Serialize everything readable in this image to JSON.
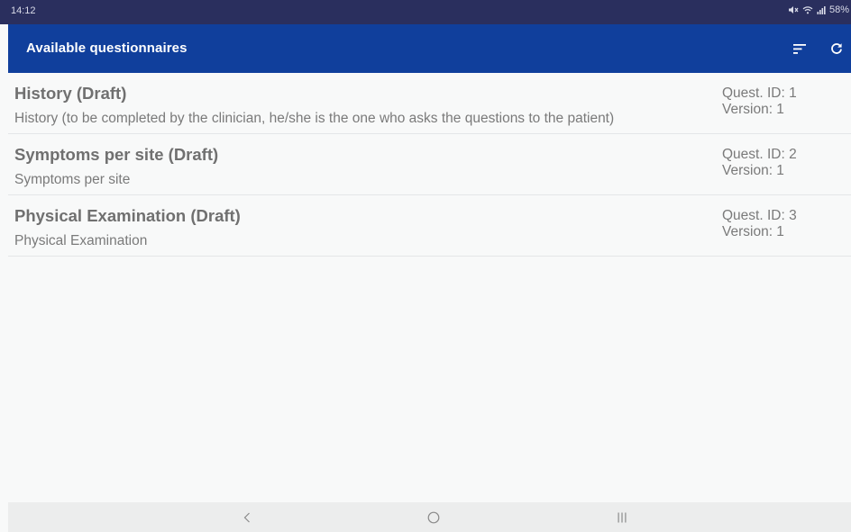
{
  "status_bar": {
    "time": "14:12",
    "battery": "58%"
  },
  "app_bar": {
    "title": "Available questionnaires",
    "actions": [
      "sort-icon",
      "refresh-icon"
    ]
  },
  "questionnaires": [
    {
      "title": "History (Draft)",
      "description": "History (to be completed by the clinician, he/she is the one who asks the questions to the patient)",
      "quest_id": "Quest. ID: 1",
      "version": "Version: 1"
    },
    {
      "title": "Symptoms per site (Draft)",
      "description": "Symptoms per site",
      "quest_id": "Quest. ID: 2",
      "version": "Version: 1"
    },
    {
      "title": "Physical Examination (Draft)",
      "description": "Physical Examination",
      "quest_id": "Quest. ID: 3",
      "version": "Version: 1"
    }
  ],
  "navigation": [
    "back-icon",
    "home-icon",
    "recents-icon"
  ],
  "colors": {
    "status_bar": "#2a2f5e",
    "app_bar": "#103f9c",
    "background": "#f8f9f9",
    "title_text": "#707070",
    "secondary_text": "#7a7a7a",
    "nav_bar": "#eceded"
  }
}
